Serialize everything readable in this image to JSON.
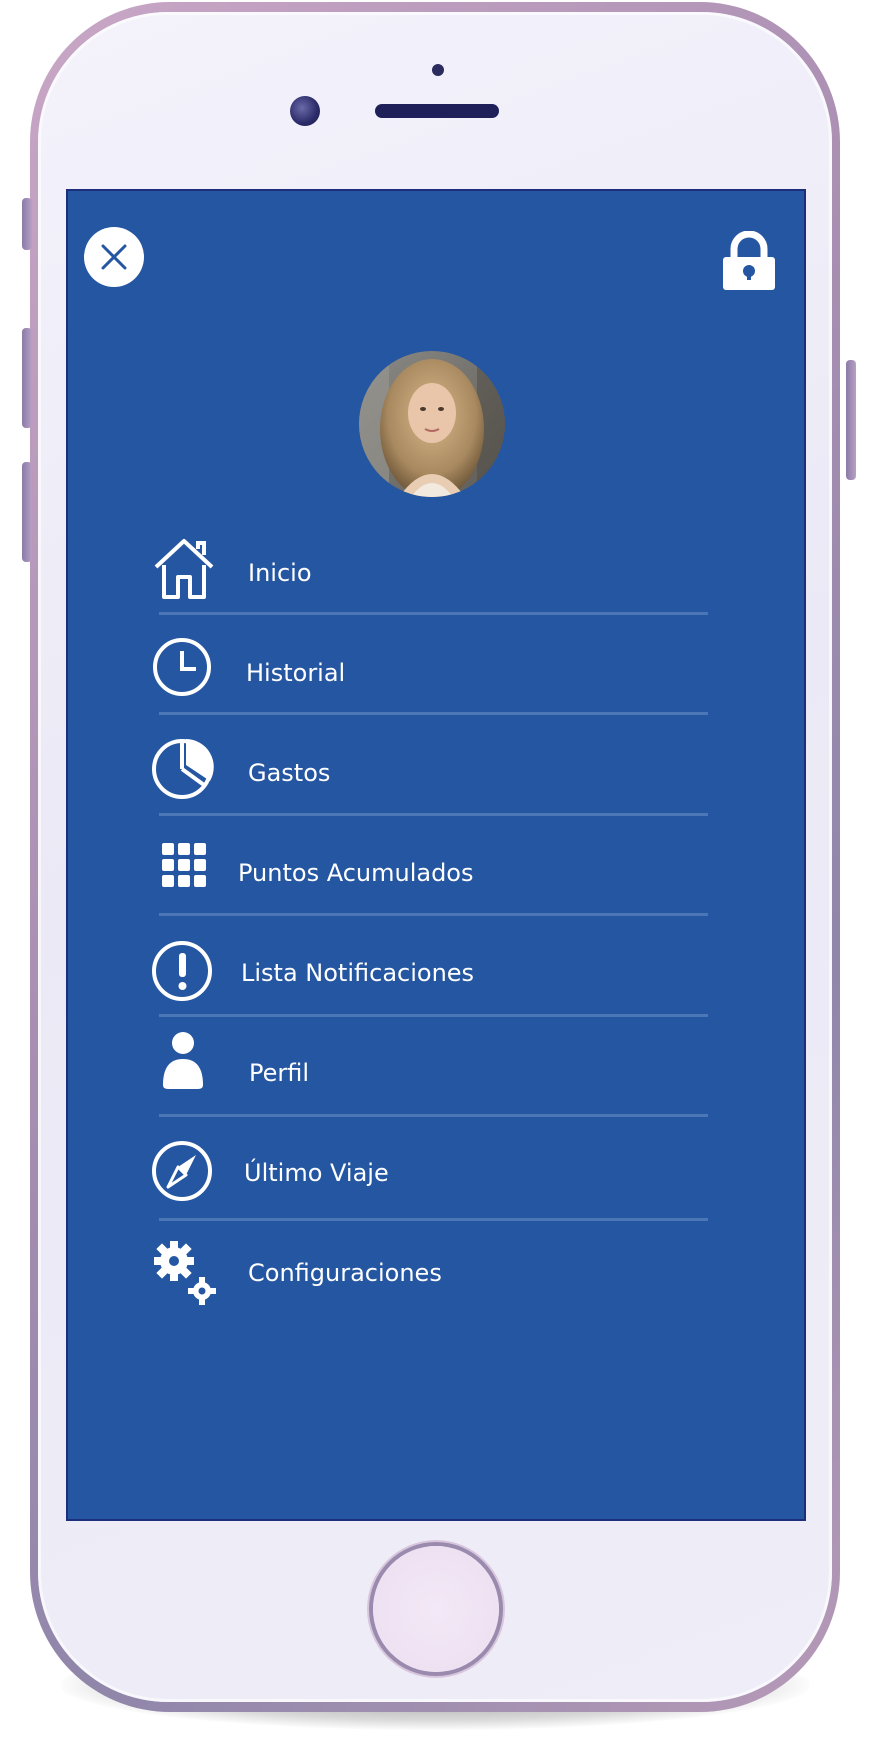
{
  "screen": {
    "background_color": "#2556a1",
    "close_button": {
      "icon": "close-icon"
    },
    "lock_button": {
      "icon": "lock-icon"
    },
    "avatar": {
      "icon": "profile-photo"
    }
  },
  "menu": {
    "items": [
      {
        "label": "Inicio",
        "icon": "home-icon"
      },
      {
        "label": "Historial",
        "icon": "clock-icon"
      },
      {
        "label": "Gastos",
        "icon": "pie-chart-icon"
      },
      {
        "label": "Puntos Acumulados",
        "icon": "grid-icon"
      },
      {
        "label": "Lista Notificaciones",
        "icon": "alert-icon"
      },
      {
        "label": "Perfil",
        "icon": "user-icon"
      },
      {
        "label": "Último Viaje",
        "icon": "compass-icon"
      },
      {
        "label": "Configuraciones",
        "icon": "gears-icon"
      }
    ]
  }
}
